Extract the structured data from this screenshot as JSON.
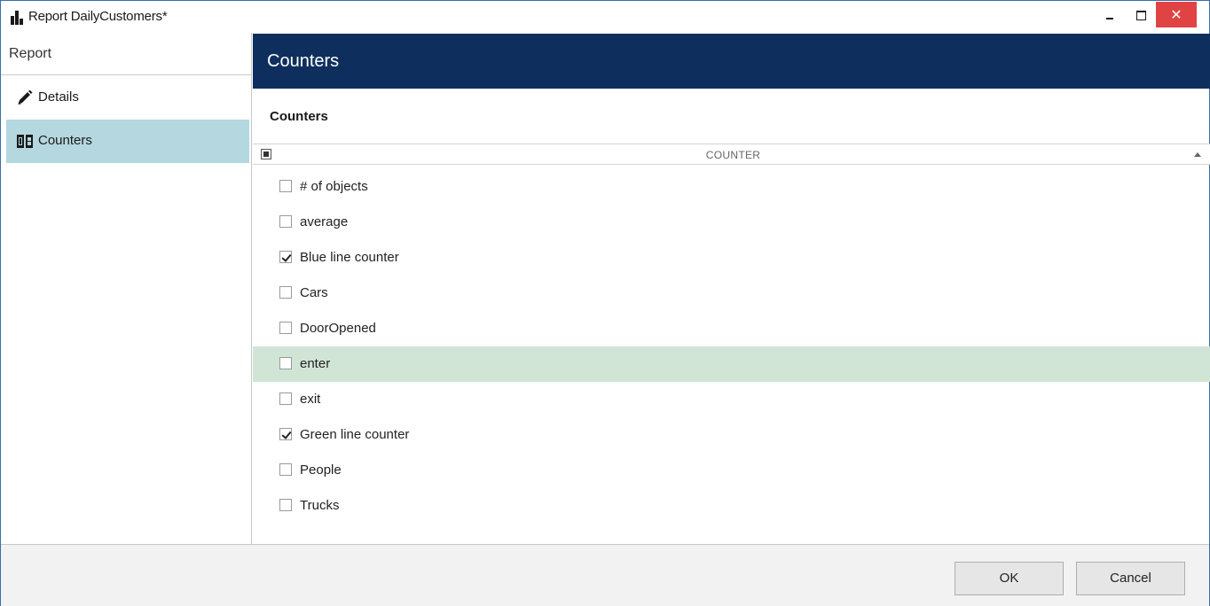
{
  "window": {
    "title": "Report DailyCustomers*",
    "close_glyph": "✕",
    "close_color": "#e04343"
  },
  "sidebar": {
    "header": "Report",
    "items": [
      {
        "label": "Details",
        "icon": "pencil-icon",
        "selected": false
      },
      {
        "label": "Counters",
        "icon": "counter-icon",
        "selected": true
      }
    ],
    "selected_color": "#b5d7df"
  },
  "main": {
    "header": "Counters",
    "header_color": "#0e2f5e",
    "section_title": "Counters",
    "column_header": "COUNTER",
    "rows": [
      {
        "label": "# of objects",
        "checked": false,
        "selected": false
      },
      {
        "label": "average",
        "checked": false,
        "selected": false
      },
      {
        "label": "Blue line counter",
        "checked": true,
        "selected": false
      },
      {
        "label": "Cars",
        "checked": false,
        "selected": false
      },
      {
        "label": "DoorOpened",
        "checked": false,
        "selected": false
      },
      {
        "label": "enter",
        "checked": false,
        "selected": true
      },
      {
        "label": "exit",
        "checked": false,
        "selected": false
      },
      {
        "label": "Green line counter",
        "checked": true,
        "selected": false
      },
      {
        "label": "People",
        "checked": false,
        "selected": false
      },
      {
        "label": "Trucks",
        "checked": false,
        "selected": false
      }
    ],
    "selected_row_color": "#d0e5d6"
  },
  "footer": {
    "ok_label": "OK",
    "cancel_label": "Cancel"
  }
}
